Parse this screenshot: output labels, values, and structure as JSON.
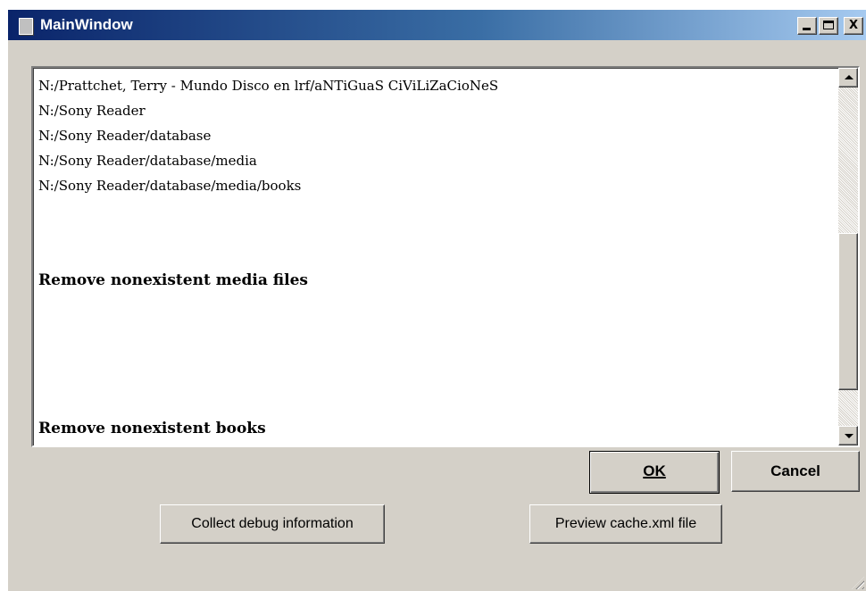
{
  "window": {
    "title": "MainWindow",
    "title_buttons": {
      "minimize": "minimize",
      "maximize": "maximize",
      "close": "X"
    }
  },
  "log": {
    "lines": [
      "N:/Prattchet, Terry - Mundo Disco en lrf/aNTiGuaS CiViLiZaCioNeS",
      "N:/Sony Reader",
      "N:/Sony Reader/database",
      "N:/Sony Reader/database/media",
      "N:/Sony Reader/database/media/books"
    ],
    "heading_media": "Remove nonexistent media files",
    "heading_books": "Remove nonexistent books"
  },
  "buttons": {
    "ok": "OK",
    "cancel": "Cancel",
    "collect_debug": "Collect debug information",
    "preview_cache": "Preview cache.xml file"
  },
  "colors": {
    "titlebar_start": "#0a246a",
    "titlebar_end": "#a6caf0",
    "window_bg": "#d4d0c8"
  },
  "icons": {
    "app": "app-window-icon",
    "scroll_up": "arrow-up-icon",
    "scroll_down": "arrow-down-icon",
    "resize": "resize-grip-icon"
  }
}
